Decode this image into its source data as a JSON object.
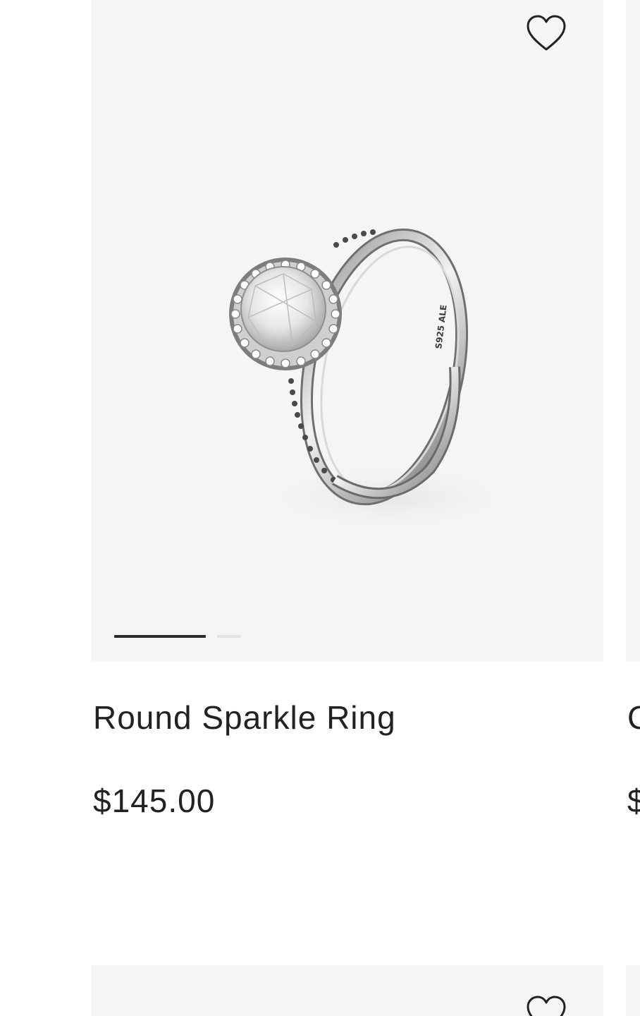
{
  "products": [
    {
      "name": "Round Sparkle Ring",
      "price": "$145.00",
      "engraving": "S925 ALE",
      "wishlist_icon": "heart-outline-icon",
      "pager": {
        "count": 2,
        "active": 1
      }
    }
  ],
  "next_column": {
    "name_partial": "C",
    "price_partial": "$"
  },
  "colors": {
    "media_bg": "#f5f5f5",
    "text": "#222222",
    "pager_active": "#2b2b2b",
    "pager_inactive": "#e4e4e4"
  }
}
